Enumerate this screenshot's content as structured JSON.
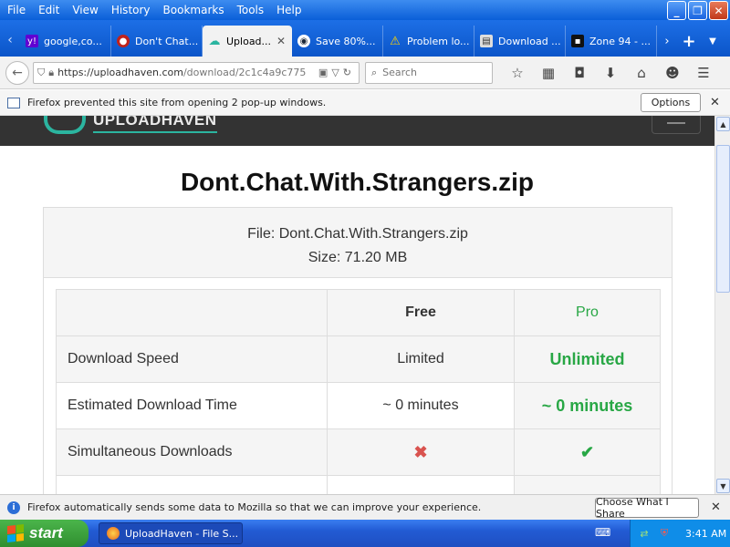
{
  "menubar": {
    "items": [
      "File",
      "Edit",
      "View",
      "History",
      "Bookmarks",
      "Tools",
      "Help"
    ],
    "window_buttons": [
      "minimize",
      "restore",
      "close"
    ]
  },
  "tabs": [
    {
      "label": "google,co...",
      "icon": "yahoo-icon",
      "active": false
    },
    {
      "label": "Don't Chat...",
      "icon": "red-favicon",
      "active": false
    },
    {
      "label": "Upload...",
      "icon": "uploadhaven-icon",
      "active": true
    },
    {
      "label": "Save 80%...",
      "icon": "steam-icon",
      "active": false
    },
    {
      "label": "Problem lo...",
      "icon": "warning-icon",
      "active": false
    },
    {
      "label": "Download ...",
      "icon": "film-icon",
      "active": false
    },
    {
      "label": "Zone 94 - ...",
      "icon": "zone94-icon",
      "active": false
    }
  ],
  "navbar": {
    "url_host": "https://uploadhaven.com",
    "url_path": "/download/2c1c4a9c775",
    "search_placeholder": "Search"
  },
  "popup_notice": {
    "text": "Firefox prevented this site from opening 2 pop-up windows.",
    "button": "Options"
  },
  "site": {
    "logo_text": "UPLOADHAVEN"
  },
  "page": {
    "title": "Dont.Chat.With.Strangers.zip",
    "file_line": "File: Dont.Chat.With.Strangers.zip",
    "size_line": "Size: 71.20 MB"
  },
  "compare": {
    "headers": [
      "",
      "Free",
      "Pro"
    ],
    "rows": [
      {
        "label": "Download Speed",
        "free": "Limited",
        "pro": "Unlimited"
      },
      {
        "label": "Estimated Download Time",
        "free": "~ 0 minutes",
        "pro": "~ 0 minutes"
      },
      {
        "label": "Simultaneous Downloads",
        "free": "✖",
        "pro": "✔"
      }
    ]
  },
  "data_notice": {
    "text": "Firefox automatically sends some data to Mozilla so that we can improve your experience.",
    "button": "Choose What I Share"
  },
  "taskbar": {
    "start_label": "start",
    "task_label": "UploadHaven - File S...",
    "clock": "3:41 AM"
  },
  "colors": {
    "pro_green": "#28a745",
    "xp_blue": "#225bd4",
    "site_header": "#333333",
    "x_red": "#d9534f"
  }
}
